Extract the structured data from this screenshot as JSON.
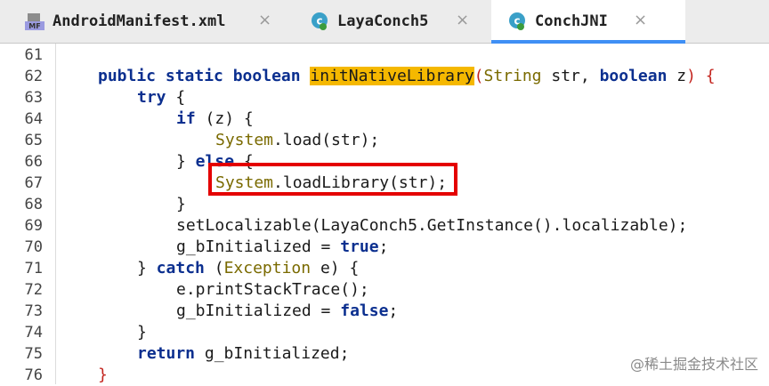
{
  "tabs": [
    {
      "label": "AndroidManifest.xml",
      "icon": "manifest-file-icon",
      "icon_text": "MF",
      "active": false
    },
    {
      "label": "LayaConch5",
      "icon": "java-class-icon",
      "active": false
    },
    {
      "label": "ConchJNI",
      "icon": "java-class-icon",
      "active": true
    }
  ],
  "close_glyph": "×",
  "colors": {
    "keyword": "#0b2f8f",
    "class": "#7a6a00",
    "highlight": "#f5b800",
    "tab_underline": "#3f8ff5",
    "box": "#e40000"
  },
  "code": {
    "line_numbers": [
      "61",
      "62",
      "63",
      "64",
      "65",
      "66",
      "67",
      "68",
      "69",
      "70",
      "71",
      "72",
      "73",
      "74",
      "75",
      "76"
    ],
    "l62": {
      "kw1": "public static boolean ",
      "method": "initNativeLibrary",
      "p_open": "(",
      "type1": "String",
      "arg1": " str, ",
      "kw2": "boolean",
      "arg2": " z",
      "p_close": ")",
      "brace": " {"
    },
    "l63": {
      "kw": "try",
      "rest": " {"
    },
    "l64": {
      "kw": "if",
      "rest": " (z) {"
    },
    "l65": {
      "cls": "System",
      "rest": ".load(str);"
    },
    "l66": {
      "close": "}",
      "kw": " else",
      "rest": " {"
    },
    "l67": {
      "cls": "System",
      "rest": ".loadLibrary(str);"
    },
    "l68": {
      "text": "}"
    },
    "l69": {
      "text": "setLocalizable(LayaConch5.GetInstance().localizable);"
    },
    "l70": {
      "pre": "g_bInitialized = ",
      "kw": "true",
      "post": ";"
    },
    "l71": {
      "close": "}",
      "kw": " catch",
      "open": " (",
      "cls": "Exception",
      "rest": " e) {"
    },
    "l72": {
      "text": "e.printStackTrace();"
    },
    "l73": {
      "pre": "g_bInitialized = ",
      "kw": "false",
      "post": ";"
    },
    "l74": {
      "text": "}"
    },
    "l75": {
      "kw": "return",
      "rest": " g_bInitialized;"
    },
    "l76": {
      "text": "}"
    }
  },
  "watermark": "@稀土掘金技术社区"
}
